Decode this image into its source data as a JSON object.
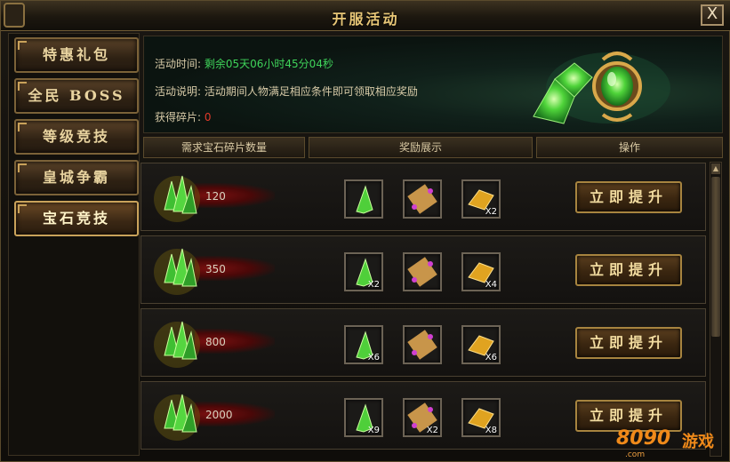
{
  "window": {
    "title": "开服活动",
    "close_label": "X"
  },
  "sidebar": {
    "items": [
      {
        "label": "特惠礼包",
        "active": false
      },
      {
        "label": "全民 BOSS",
        "active": false
      },
      {
        "label": "等级竞技",
        "active": false
      },
      {
        "label": "皇城争霸",
        "active": false
      },
      {
        "label": "宝石竞技",
        "active": true
      }
    ]
  },
  "info": {
    "time_label": "活动时间:",
    "time_value": "剩余05天06小时45分04秒",
    "desc_label": "活动说明:",
    "desc_value": "活动期间人物满足相应条件即可领取相应奖励",
    "frag_label": "获得碎片:",
    "frag_value": "0"
  },
  "columns": {
    "required": "需求宝石碎片数量",
    "rewards": "奖励展示",
    "action": "操作"
  },
  "rows": [
    {
      "required": "120",
      "items": [
        {
          "icon": "gem-shard-icon",
          "count": ""
        },
        {
          "icon": "scroll-icon",
          "count": ""
        },
        {
          "icon": "gold-ingot-icon",
          "count": "X2"
        }
      ],
      "button": "立即提升"
    },
    {
      "required": "350",
      "items": [
        {
          "icon": "gem-shard-icon",
          "count": "X2"
        },
        {
          "icon": "scroll-icon",
          "count": ""
        },
        {
          "icon": "gold-ingot-icon",
          "count": "X4"
        }
      ],
      "button": "立即提升"
    },
    {
      "required": "800",
      "items": [
        {
          "icon": "gem-shard-icon",
          "count": "X6"
        },
        {
          "icon": "scroll-icon",
          "count": ""
        },
        {
          "icon": "gold-ingot-icon",
          "count": "X6"
        }
      ],
      "button": "立即提升"
    },
    {
      "required": "2000",
      "items": [
        {
          "icon": "gem-shard-icon",
          "count": "X9"
        },
        {
          "icon": "scroll-icon",
          "count": "X2"
        },
        {
          "icon": "gold-ingot-icon",
          "count": "X8"
        }
      ],
      "button": "立即提升"
    }
  ],
  "watermark": {
    "brand": "8090",
    "suffix": "游戏",
    "domain": ".com"
  },
  "colors": {
    "accent_gold": "#e8c777",
    "timer_green": "#3fd45a",
    "fragment_red": "#e33a2a"
  }
}
